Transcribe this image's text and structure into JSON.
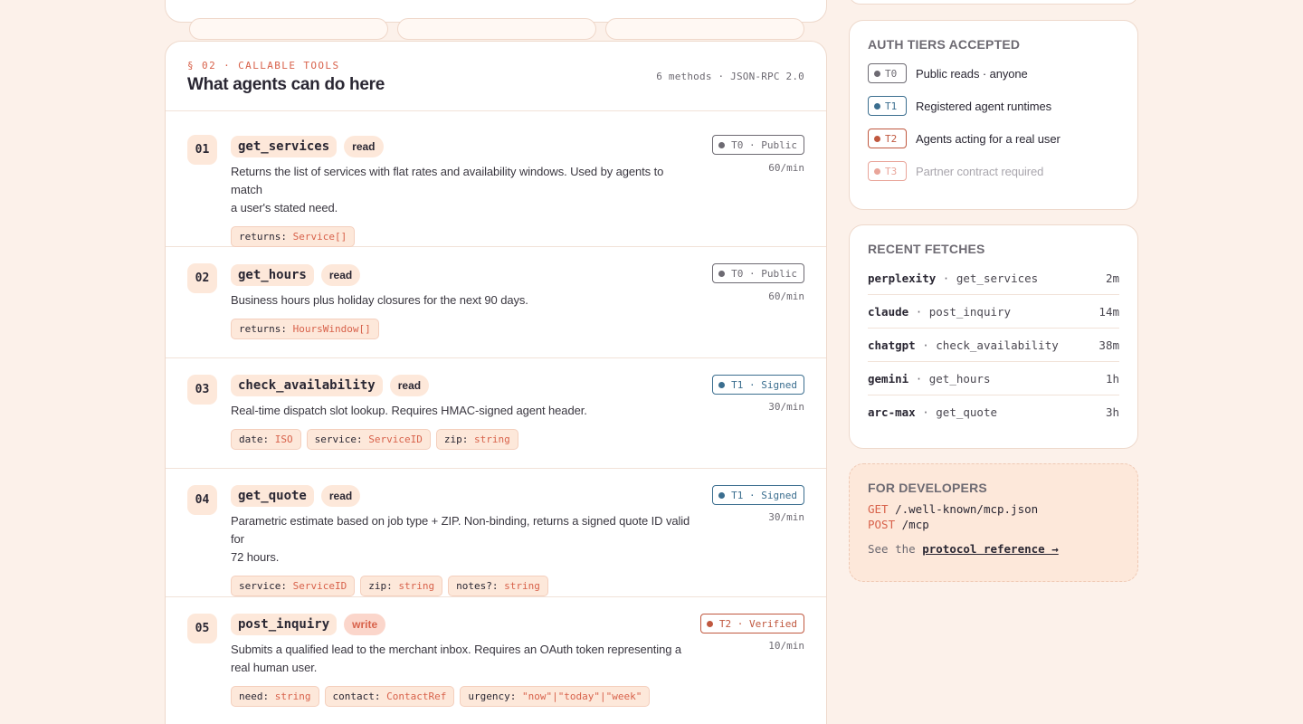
{
  "tools_section": {
    "kicker": "§ 02 · CALLABLE TOOLS",
    "title": "What agents can do here",
    "meta": "6 methods · JSON-RPC 2.0"
  },
  "tools": [
    {
      "num": "01",
      "name": "get_services",
      "kind": "read",
      "desc_lines": [
        "Returns the list of services with flat rates and availability windows. Used by agents to match",
        "a user's stated need."
      ],
      "params": [
        {
          "key": "returns:",
          "type": "Service[]"
        }
      ],
      "tier": "T0 · Public",
      "rate": "60/min"
    },
    {
      "num": "02",
      "name": "get_hours",
      "kind": "read",
      "desc_lines": [
        "Business hours plus holiday closures for the next 90 days."
      ],
      "params": [
        {
          "key": "returns:",
          "type": "HoursWindow[]"
        }
      ],
      "tier": "T0 · Public",
      "rate": "60/min"
    },
    {
      "num": "03",
      "name": "check_availability",
      "kind": "read",
      "desc_lines": [
        "Real-time dispatch slot lookup. Requires HMAC-signed agent header."
      ],
      "params": [
        {
          "key": "date:",
          "type": "ISO"
        },
        {
          "key": "service:",
          "type": "ServiceID"
        },
        {
          "key": "zip:",
          "type": "string"
        }
      ],
      "tier": "T1 · Signed",
      "rate": "30/min"
    },
    {
      "num": "04",
      "name": "get_quote",
      "kind": "read",
      "desc_lines": [
        "Parametric estimate based on job type + ZIP. Non-binding, returns a signed quote ID valid for",
        "72 hours."
      ],
      "params": [
        {
          "key": "service:",
          "type": "ServiceID"
        },
        {
          "key": "zip:",
          "type": "string"
        },
        {
          "key": "notes?:",
          "type": "string"
        }
      ],
      "tier": "T1 · Signed",
      "rate": "30/min"
    },
    {
      "num": "05",
      "name": "post_inquiry",
      "kind": "write",
      "desc_lines": [
        "Submits a qualified lead to the merchant inbox. Requires an OAuth token representing a",
        "real human user."
      ],
      "params": [
        {
          "key": "need:",
          "type": "string"
        },
        {
          "key": "contact:",
          "type": "ContactRef"
        },
        {
          "key": "urgency:",
          "type": "\"now\"|\"today\"|\"week\""
        }
      ],
      "tier": "T2 · Verified",
      "rate": "10/min"
    }
  ],
  "auth": {
    "title": "AUTH TIERS ACCEPTED",
    "tiers": [
      {
        "code": "T0",
        "label": "Public reads · anyone"
      },
      {
        "code": "T1",
        "label": "Registered agent runtimes"
      },
      {
        "code": "T2",
        "label": "Agents acting for a real user"
      },
      {
        "code": "T3",
        "label": "Partner contract required"
      }
    ]
  },
  "recent": {
    "title": "RECENT FETCHES",
    "rows": [
      {
        "agent": "perplexity",
        "sep": "·",
        "method": "get_services",
        "ago": "2m"
      },
      {
        "agent": "claude",
        "sep": "·",
        "method": "post_inquiry",
        "ago": "14m"
      },
      {
        "agent": "chatgpt",
        "sep": "·",
        "method": "check_availability",
        "ago": "38m"
      },
      {
        "agent": "gemini",
        "sep": "·",
        "method": "get_hours",
        "ago": "1h"
      },
      {
        "agent": "arc-max",
        "sep": "·",
        "method": "get_quote",
        "ago": "3h"
      }
    ]
  },
  "developers": {
    "title": "FOR DEVELOPERS",
    "endpoints": [
      {
        "verb": "GET",
        "path": "/.well-known/mcp.json"
      },
      {
        "verb": "POST",
        "path": "/mcp"
      }
    ],
    "see_the": "See the",
    "link": "protocol reference →"
  },
  "colors": {
    "accent": "#d8624b",
    "tier_t0": "#6d6a72",
    "tier_t1": "#3b6e8f",
    "tier_t2": "#c0583f",
    "tier_t3": "#e9a59a",
    "background": "#fcf1ea",
    "chip": "#fde8da"
  }
}
